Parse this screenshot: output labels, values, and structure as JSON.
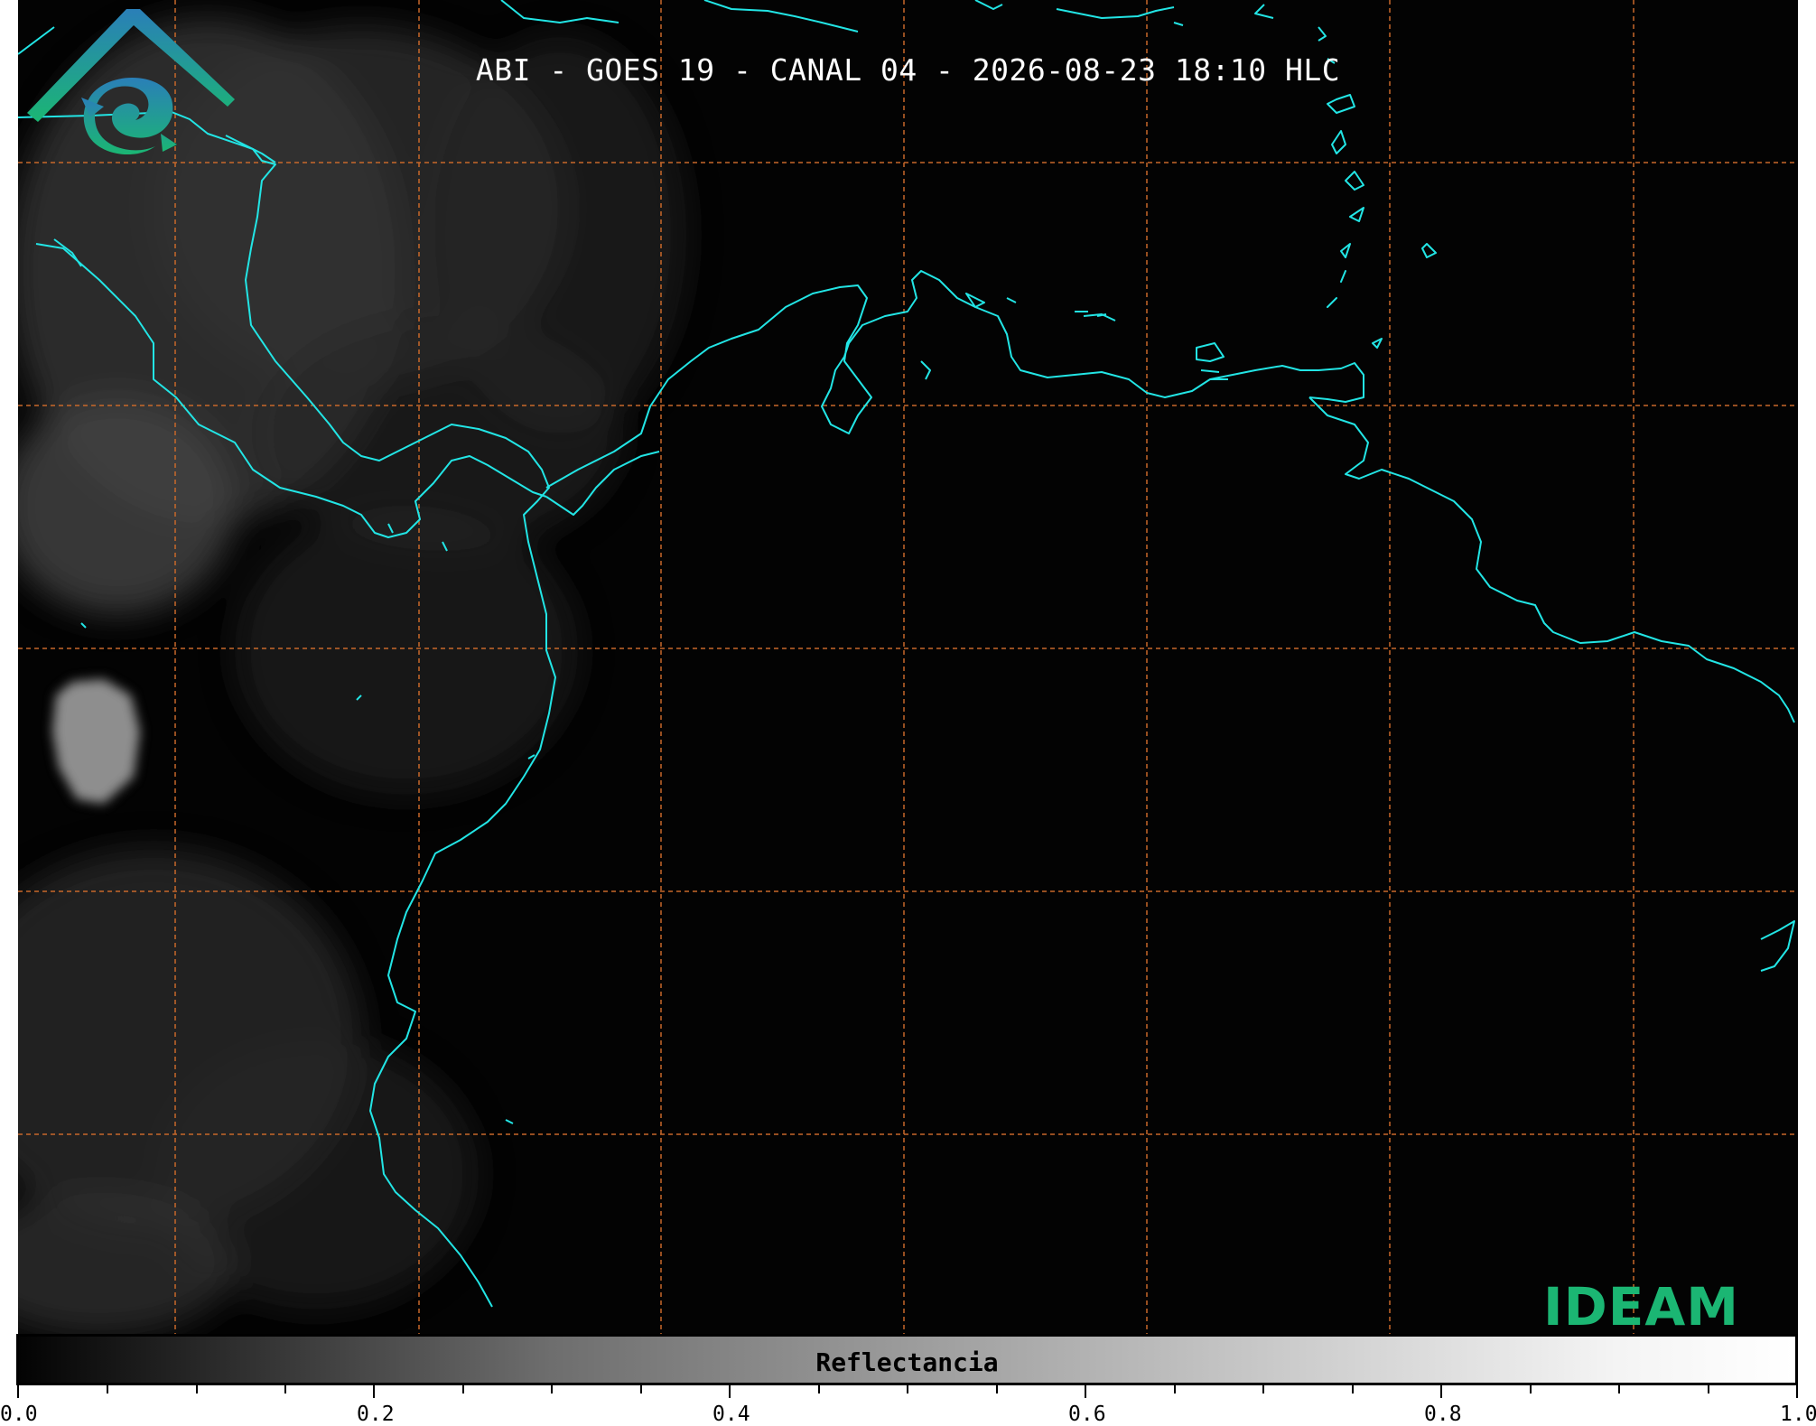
{
  "title": "ABI - GOES 19 - CANAL 04 - 2026-08-23 18:10 HLC",
  "logo_text": "IDEAM",
  "colors": {
    "background": "#030303",
    "coastline": "#22e5e5",
    "gridline": "#c8682a",
    "logo_green": "#1bb673",
    "logo_blue": "#2a7fb8"
  },
  "colorbar": {
    "label": "Reflectancia",
    "min": 0.0,
    "max": 1.0,
    "ticks": [
      "0.0",
      "0.2",
      "0.4",
      "0.6",
      "0.8",
      "1.0"
    ],
    "minor_tick_step": 0.05,
    "colormap": "grayscale black-to-white"
  },
  "map": {
    "grid": "on, dashed",
    "coastlines": "on"
  }
}
